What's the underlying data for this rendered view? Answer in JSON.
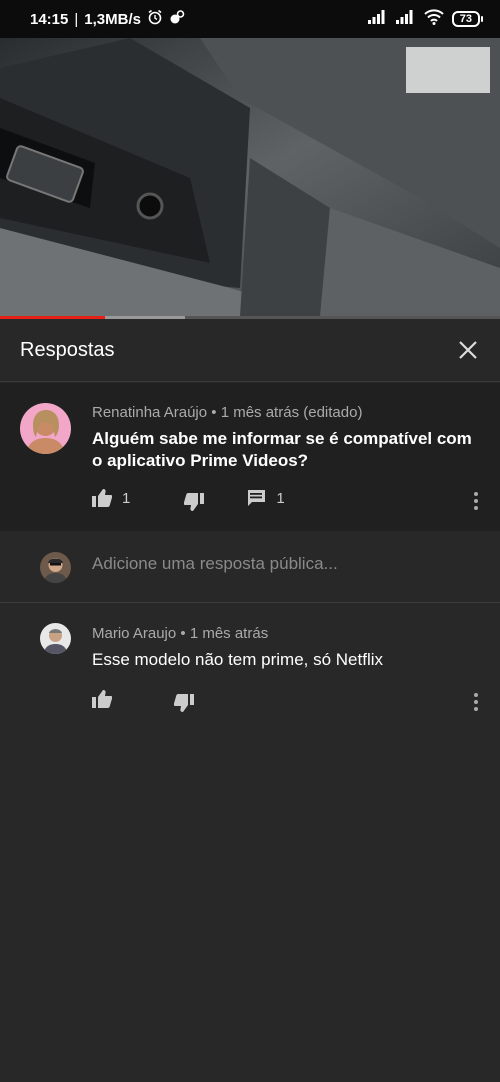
{
  "status_bar": {
    "time": "14:15",
    "separator": "|",
    "speed": "1,3MB/s",
    "battery": "73"
  },
  "video": {
    "progress_played_pct": 21,
    "progress_buffered_pct": 37
  },
  "panel": {
    "title": "Respostas"
  },
  "parent_comment": {
    "author": "Renatinha Araújo",
    "dot": "•",
    "time": "1 mês atrás (editado)",
    "text": "Alguém sabe me informar se é compatível com o aplicativo Prime Videos?",
    "likes": "1",
    "replies": "1"
  },
  "reply_box": {
    "placeholder": "Adicione uma resposta pública..."
  },
  "replies": [
    {
      "author": "Mario Araujo",
      "dot": "•",
      "time": "1 mês atrás",
      "text": "Esse modelo não tem prime, só Netflix"
    }
  ],
  "colors": {
    "accent_red": "#e62117",
    "background": "#282828",
    "parent_bg": "#202020"
  }
}
